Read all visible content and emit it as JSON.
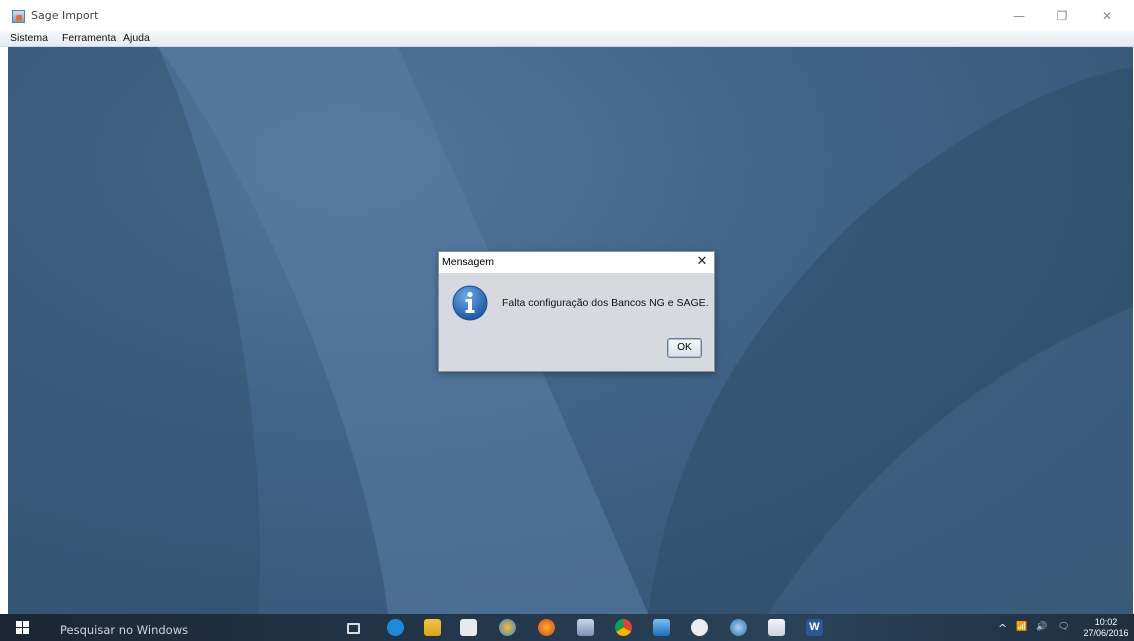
{
  "window": {
    "title": "Sage Import",
    "controls": {
      "minimize": "—",
      "maximize": "❐",
      "close": "✕"
    }
  },
  "menubar": {
    "items": [
      "Sistema",
      "Ferramenta",
      "Ajuda"
    ]
  },
  "dialog": {
    "title": "Mensagem",
    "close_glyph": "✕",
    "icon": "info-icon",
    "message": "Falta configuração dos Bancos NG e SAGE.",
    "ok_label": "OK"
  },
  "taskbar": {
    "search_placeholder": "Pesquisar no Windows",
    "apps": [
      "task-view-icon",
      "edge-icon",
      "file-explorer-icon",
      "store-icon",
      "app-icon",
      "firefox-icon",
      "paint-icon",
      "chrome-icon",
      "virtualbox-icon",
      "vpn-icon",
      "network-app-icon",
      "java-icon",
      "word-icon"
    ],
    "tray": {
      "chevron": "^",
      "network": "📶",
      "volume": "🔊",
      "notifications": "🗨"
    },
    "clock": {
      "time": "10:02",
      "date": "27/06/2016"
    }
  },
  "colors": {
    "desktop": "#3f6287",
    "taskbar": "#23364a",
    "dialog_bg": "#d6d9df",
    "info_icon": "#2f6db5"
  }
}
